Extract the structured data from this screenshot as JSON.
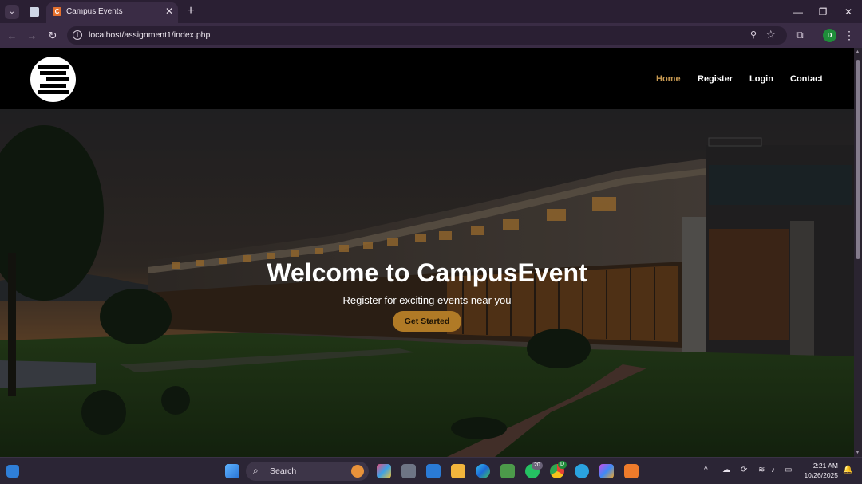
{
  "browser": {
    "tab_dropdown_icon": "chevron-down-icon",
    "active_tab_title": "Campus Events",
    "active_tab_favicon": "C",
    "url": "localhost/assignment1/index.php",
    "profile_initial": "D",
    "accent": "#3a2c45"
  },
  "site": {
    "nav": [
      {
        "label": "Home",
        "active": true
      },
      {
        "label": "Register",
        "active": false
      },
      {
        "label": "Login",
        "active": false
      },
      {
        "label": "Contact",
        "active": false
      }
    ],
    "active_color": "#c89a52",
    "hero": {
      "title": "Welcome to CampusEvent",
      "subtitle": "Register for exciting events near you",
      "cta_label": "Get Started",
      "cta_color": "#b07a26"
    }
  },
  "taskbar": {
    "search_label": "Search",
    "whatsapp_badge": "20",
    "chrome_badge": "D",
    "time": "2:21 AM",
    "date": "10/26/2025"
  }
}
